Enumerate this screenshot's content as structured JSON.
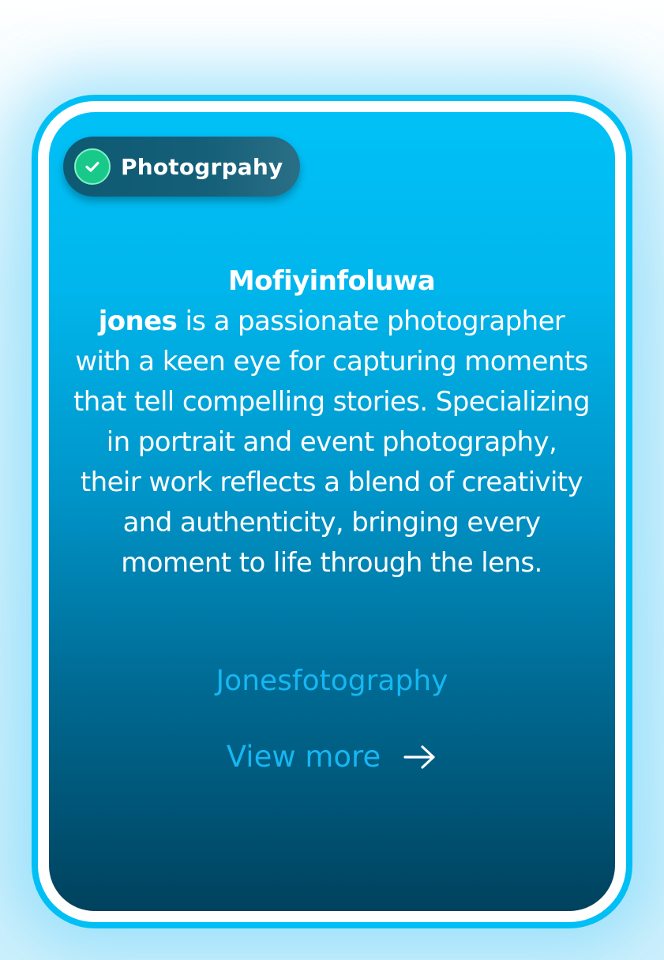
{
  "badge": {
    "icon": "check-circle-icon",
    "label": "Photogrpahy",
    "icon_color": "#19c98a"
  },
  "bio": {
    "name_first": "Mofiyinfoluwa",
    "name_last": "jones",
    "text": " is a passionate photographer with a keen eye for capturing moments that tell compelling stories. Specializing in portrait and event photography, their work reflects a blend of creativity and authenticity, bringing every moment to life through the lens."
  },
  "handle": "Jonesfotography",
  "cta": {
    "label": "View more",
    "icon": "arrow-right-icon"
  },
  "colors": {
    "accent": "#00bff5",
    "link": "#15b7f2",
    "card_top": "#00c1f7",
    "card_bottom": "#00425e"
  }
}
